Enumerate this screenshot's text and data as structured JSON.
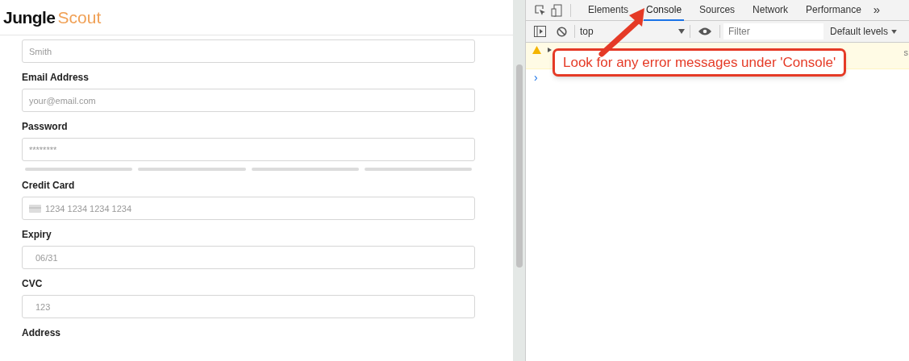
{
  "logo": {
    "part_1": "Jungle",
    "part_2": "Scout"
  },
  "form": {
    "fields": [
      {
        "kind": "text",
        "placeholder": "Smith"
      },
      {
        "kind": "text",
        "label": "Email Address",
        "placeholder": "your@email.com"
      },
      {
        "kind": "password",
        "label": "Password",
        "placeholder": "********",
        "strength": {
          "level": 0
        }
      },
      {
        "kind": "card",
        "label": "Credit Card",
        "placeholder": "1234 1234 1234 1234"
      },
      {
        "kind": "text",
        "label": "Expiry",
        "placeholder": "06/31"
      },
      {
        "kind": "text",
        "label": "CVC",
        "placeholder": "123"
      },
      {
        "kind": "label_only",
        "label": "Address"
      }
    ]
  },
  "devtools": {
    "tabs": [
      {
        "label": "Elements",
        "selected": false
      },
      {
        "label": "Console",
        "selected": true
      },
      {
        "label": "Sources",
        "selected": false
      },
      {
        "label": "Network",
        "selected": false
      },
      {
        "label": "Performance",
        "selected": false
      }
    ],
    "more": "»",
    "context": "top",
    "filter_placeholder": "Filter",
    "levels": "Default levels",
    "warning_cut": "s",
    "prompt": "›"
  },
  "annotation": {
    "text": "Look for any error messages under 'Console'"
  }
}
